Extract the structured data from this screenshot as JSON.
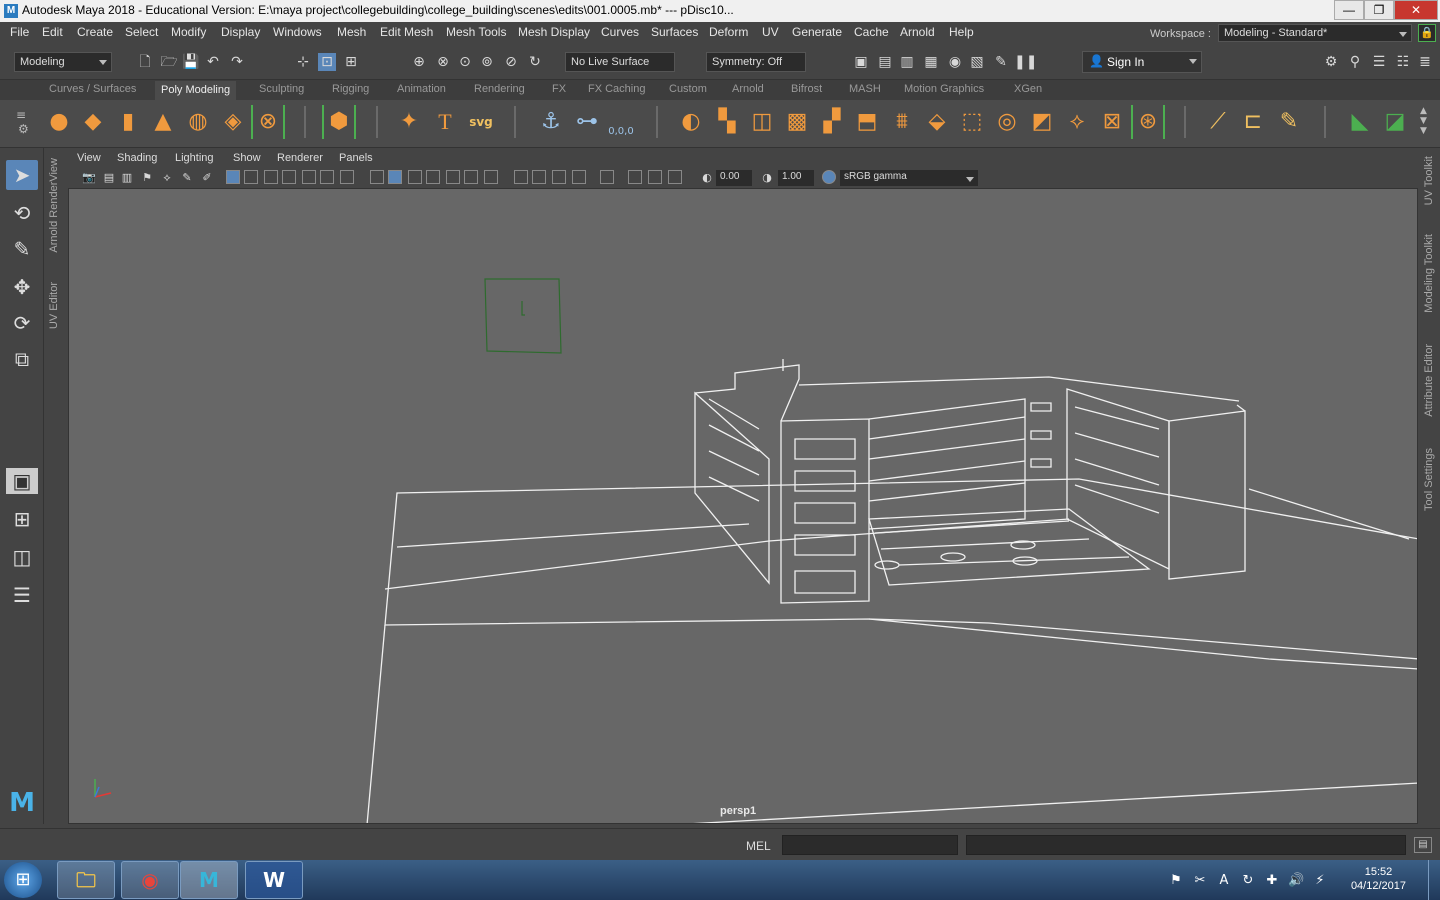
{
  "window": {
    "title": "Autodesk Maya 2018 - Educational Version: E:\\maya project\\collegebuilding\\college_building\\scenes\\edits\\001.0005.mb*   ---   pDisc10...",
    "minimize": "—",
    "maximize": "❐",
    "close": "✕"
  },
  "menus": [
    "File",
    "Edit",
    "Create",
    "Select",
    "Modify",
    "Display",
    "Windows",
    "Mesh",
    "Edit Mesh",
    "Mesh Tools",
    "Mesh Display",
    "Curves",
    "Surfaces",
    "Deform",
    "UV",
    "Generate",
    "Cache",
    "Arnold",
    "Help"
  ],
  "workspace": {
    "label": "Workspace :",
    "value": "Modeling - Standard*"
  },
  "status": {
    "mode": "Modeling",
    "live_surface": "No Live Surface",
    "symmetry": "Symmetry: Off",
    "sign_in": "Sign In"
  },
  "shelf_tabs": [
    "Curves / Surfaces",
    "Poly Modeling",
    "Sculpting",
    "Rigging",
    "Animation",
    "Rendering",
    "FX",
    "FX Caching",
    "Custom",
    "Arnold",
    "Bifrost",
    "MASH",
    "Motion Graphics",
    "XGen"
  ],
  "active_shelf_tab": "Poly Modeling",
  "shelf_text": {
    "svg": "svg",
    "type_tool": "T",
    "coords": "0,0,0"
  },
  "left_tabs": {
    "render_view": "Arnold RenderView",
    "uv_editor": "UV Editor"
  },
  "panel_menus": [
    "View",
    "Shading",
    "Lighting",
    "Show",
    "Renderer",
    "Panels"
  ],
  "panel_fields": {
    "exposure": "0.00",
    "gamma": "1.00",
    "color_space": "sRGB gamma"
  },
  "viewport": {
    "camera": "persp1"
  },
  "right_tabs": [
    "UV Toolkit",
    "Modeling Toolkit",
    "Attribute Editor",
    "Tool Settings"
  ],
  "command": {
    "label": "MEL"
  },
  "taskbar": {
    "apps": [
      "file-explorer",
      "chrome",
      "maya",
      "word"
    ],
    "maya_label": "M",
    "word_label": "W",
    "time": "15:52",
    "date": "04/12/2017"
  },
  "colors": {
    "accent": "#5a86b8",
    "shelf_bracket": "#4caf50",
    "viewport_bg": "#676767",
    "ui_bg": "#444444"
  }
}
